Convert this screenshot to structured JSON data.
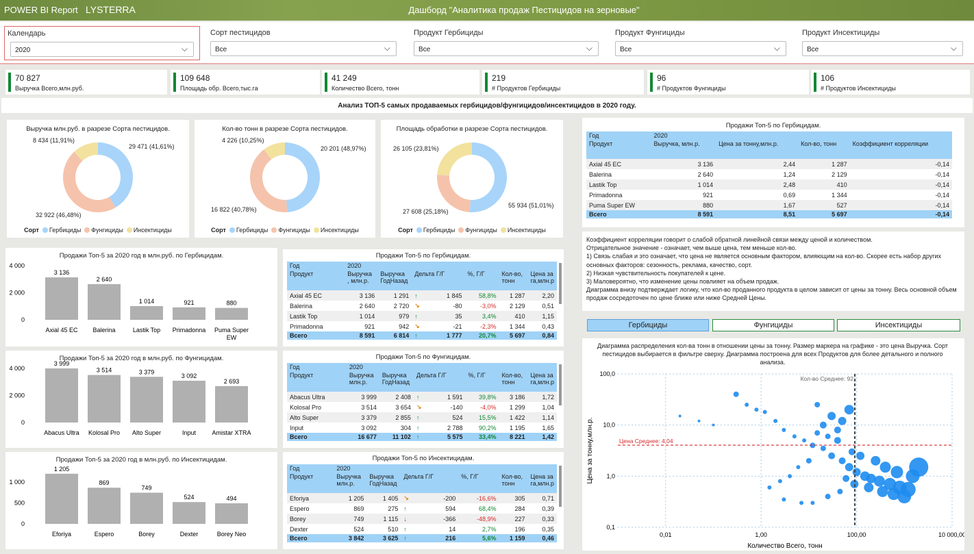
{
  "header": {
    "app": "POWER BI Report",
    "brand": "LYSTERRA",
    "title": "Дашборд \"Аналитика продаж Пестицидов на зерновые\""
  },
  "filters": [
    {
      "label": "Календарь",
      "value": "2020"
    },
    {
      "label": "Сорт пестицидов",
      "value": "Все"
    },
    {
      "label": "Продукт Гербициды",
      "value": "Все"
    },
    {
      "label": "Продукт Фунгициды",
      "value": "Все"
    },
    {
      "label": "Продукт Инсектициды",
      "value": "Все"
    }
  ],
  "kpis": [
    {
      "value": "70 827",
      "label": "Выручка Всего,млн.руб."
    },
    {
      "value": "109 648",
      "label": "Площадь обр. Всего,тыс.га"
    },
    {
      "value": "41 249",
      "label": "Количество Всего, тонн"
    },
    {
      "value": "219",
      "label": "# Продуктов Гербициды"
    },
    {
      "value": "96",
      "label": "# Продуктов Фунгициды"
    },
    {
      "value": "106",
      "label": "# Продуктов Инсектициды"
    }
  ],
  "section_title": "Анализ ТОП-5 самых продаваемых гербицидов/фунгицидов/инсектицидов в 2020 году.",
  "colors": {
    "herb": "#a8d4fa",
    "fung": "#f5c3ab",
    "insect": "#f2e29d",
    "bar": "#b0b0b0",
    "scatter": "#1e8cf0"
  },
  "legend": {
    "title": "Сорт",
    "items": [
      "Гербициды",
      "Фунгициды",
      "Инсектициды"
    ]
  },
  "donuts": [
    {
      "title": "Выручка млн.руб. в разрезе Сорта пестицидов.",
      "labels": [
        "29 471 (41,61%)",
        "32 922 (46,48%)",
        "8 434 (11,91%)"
      ],
      "values": [
        29471,
        32922,
        8434
      ]
    },
    {
      "title": "Кол-во тонн в разрезе Сорта пестицидов.",
      "labels": [
        "20 201 (48,97%)",
        "16 822 (40,78%)",
        "4 226 (10,25%)"
      ],
      "values": [
        20201,
        16822,
        4226
      ]
    },
    {
      "title": "Площадь обработки в разрезе Сорта пестицидов.",
      "labels": [
        "55 934 (51,01%)",
        "27 608 (25,18%)",
        "26 105 (23,81%)"
      ],
      "values": [
        55934,
        27608,
        26105
      ]
    }
  ],
  "bars": [
    {
      "title": "Продажи Топ-5 за 2020 год в млн.руб. по Гербицидам.",
      "ticks": [
        "4 000",
        "2 000",
        "0"
      ],
      "max": 4000,
      "categories": [
        "Axial 45 EC",
        "Balerina",
        "Lastik Top",
        "Primadonna",
        "Puma Super EW"
      ],
      "values": [
        3136,
        2640,
        1014,
        921,
        880
      ],
      "labels": [
        "3 136",
        "2 640",
        "1 014",
        "921",
        "880"
      ]
    },
    {
      "title": "Продажи Топ-5 за 2020 год в млн.руб. по Фунгицидам.",
      "ticks": [
        "4 000",
        "2 000",
        "0"
      ],
      "max": 4000,
      "categories": [
        "Abacus Ultra",
        "Kolosal Pro",
        "Alto Super",
        "Input",
        "Amistar XTRA"
      ],
      "values": [
        3999,
        3514,
        3379,
        3092,
        2693
      ],
      "labels": [
        "3 999",
        "3 514",
        "3 379",
        "3 092",
        "2 693"
      ]
    },
    {
      "title": "Продажи Топ-5 за 2020 год в млн.руб. по Инсектицидам.",
      "ticks": [
        "1 000",
        "500",
        "0"
      ],
      "max": 1300,
      "categories": [
        "Eforiya",
        "Espero",
        "Borey",
        "Dexter",
        "Borey Neo"
      ],
      "values": [
        1205,
        869,
        749,
        524,
        494
      ],
      "labels": [
        "1 205",
        "869",
        "749",
        "524",
        "494"
      ]
    }
  ],
  "tables": [
    {
      "title": "Продажи Топ-5 по Гербицидам.",
      "year_label": "Год",
      "year": "2020",
      "headers": [
        "Продукт",
        "Выручка , млн.р.",
        "Выручка ГодНазад",
        "Дельта Г/Г",
        "%, Г/Г",
        "Кол-во, тонн",
        "Цена за га,млн.р"
      ],
      "rows": [
        [
          "Axial 45 EC",
          "3 136",
          "1 291",
          "up",
          "1 845",
          "58,8%",
          "1 287",
          "2,20"
        ],
        [
          "Balerina",
          "2 640",
          "2 720",
          "dn",
          "-80",
          "-3,0%",
          "2 129",
          "0,51"
        ],
        [
          "Lastik Top",
          "1 014",
          "979",
          "up",
          "35",
          "3,4%",
          "410",
          "1,15"
        ],
        [
          "Primadonna",
          "921",
          "942",
          "dn",
          "-21",
          "-2,3%",
          "1 344",
          "0,43"
        ]
      ],
      "total": [
        "Всего",
        "8 591",
        "6 814",
        "up",
        "1 777",
        "20,7%",
        "5 697",
        "0,84"
      ]
    },
    {
      "title": "Продажи Топ-5 по Фунгицидам.",
      "year_label": "Год",
      "year": "2020",
      "headers": [
        "Продукт",
        "Выручка млн.р.",
        "Выручка ГодНазад",
        "Дельта Г/Г",
        "%, Г/Г",
        "Кол-во, тонн",
        "Цена за га,млн.р"
      ],
      "rows": [
        [
          "Abacus Ultra",
          "3 999",
          "2 408",
          "up",
          "1 591",
          "39,8%",
          "3 186",
          "1,72"
        ],
        [
          "Kolosal Pro",
          "3 514",
          "3 654",
          "dn",
          "-140",
          "-4,0%",
          "1 299",
          "1,04"
        ],
        [
          "Alto Super",
          "3 379",
          "2 855",
          "up",
          "524",
          "15,5%",
          "1 422",
          "1,14"
        ],
        [
          "Input",
          "3 092",
          "304",
          "up",
          "2 788",
          "90,2%",
          "1 195",
          "1,65"
        ]
      ],
      "total": [
        "Всего",
        "16 677",
        "11 102",
        "up",
        "5 575",
        "33,4%",
        "8 221",
        "1,42"
      ]
    },
    {
      "title": "Продажи Топ-5 по Инсектицидам.",
      "year_label": "Год",
      "year": "2020",
      "headers": [
        "Продукт",
        "Выручка млн.р.",
        "Выручка ГодНазад",
        "Дельта Г/Г",
        "%, Г/Г",
        "Кол-во, тонн",
        "Цена за га,млн.р"
      ],
      "rows": [
        [
          "Eforiya",
          "1 205",
          "1 405",
          "dn",
          "-200",
          "-16,6%",
          "305",
          "0,71"
        ],
        [
          "Espero",
          "869",
          "275",
          "up",
          "594",
          "68,4%",
          "284",
          "0,39"
        ],
        [
          "Borey",
          "749",
          "1 115",
          "dnr",
          "-366",
          "-48,9%",
          "227",
          "0,33"
        ],
        [
          "Dexter",
          "524",
          "510",
          "up",
          "14",
          "2,7%",
          "196",
          "0,35"
        ]
      ],
      "total": [
        "Всего",
        "3 842",
        "3 625",
        "up",
        "216",
        "5,6%",
        "1 159",
        "0,46"
      ]
    }
  ],
  "corr_table": {
    "title": "Продажи Топ-5 по Гербицидам.",
    "year_label": "Год",
    "year": "2020",
    "headers": [
      "Продукт",
      "Выручка, млн.р.",
      "Цена за тонну,млн.р.",
      "Кол-во, тонн",
      "Коэффициент корреляции"
    ],
    "rows": [
      [
        "Axial 45 EC",
        "3 136",
        "2,44",
        "1 287",
        "-0,14"
      ],
      [
        "Balerina",
        "2 640",
        "1,24",
        "2 129",
        "-0,14"
      ],
      [
        "Lastik Top",
        "1 014",
        "2,48",
        "410",
        "-0,14"
      ],
      [
        "Primadonna",
        "921",
        "0,69",
        "1 344",
        "-0,14"
      ],
      [
        "Puma Super EW",
        "880",
        "1,67",
        "527",
        "-0,14"
      ]
    ],
    "total": [
      "Всего",
      "8 591",
      "8,51",
      "5 697",
      "-0,14"
    ]
  },
  "notes": [
    "Коэффициент корреляции говорит о слабой обратной линейной связи между ценой и количеством.",
    "Отрицательное значение - означает, чем выше цена, тем меньше кол-во.",
    "1) Связь слабая и это означает, что цена не является основным фактором, влияющим на кол-во. Скорее есть набор других основных факторов: сезонность, реклама, качество, сорт.",
    "2) Низкая чувствительность покупателей к цене.",
    "3) Маловероятно, что изменение цены повлияет на объем продаж.",
    "Диаграмма внизу подтверждает логику, что кол-во проданного продукта в целом зависит от цены за тонну. Весь основной объем продаж сосредоточен по цене ближе или ниже Средней Цены."
  ],
  "tabs": [
    "Гербициды",
    "Фунгициды",
    "Инсектициды"
  ],
  "chart_data": [
    {
      "type": "pie",
      "title": "Выручка млн.руб. в разрезе Сорта пестицидов.",
      "categories": [
        "Гербициды",
        "Фунгициды",
        "Инсектициды"
      ],
      "values": [
        29471,
        32922,
        8434
      ]
    },
    {
      "type": "pie",
      "title": "Кол-во тонн в разрезе Сорта пестицидов.",
      "categories": [
        "Гербициды",
        "Фунгициды",
        "Инсектициды"
      ],
      "values": [
        20201,
        16822,
        4226
      ]
    },
    {
      "type": "pie",
      "title": "Площадь обработки в разрезе Сорта пестицидов.",
      "categories": [
        "Гербициды",
        "Фунгициды",
        "Инсектициды"
      ],
      "values": [
        55934,
        27608,
        26105
      ]
    },
    {
      "type": "bar",
      "title": "Продажи Топ-5 за 2020 год в млн.руб. по Гербицидам.",
      "categories": [
        "Axial 45 EC",
        "Balerina",
        "Lastik Top",
        "Primadonna",
        "Puma Super EW"
      ],
      "values": [
        3136,
        2640,
        1014,
        921,
        880
      ],
      "ylim": [
        0,
        4000
      ]
    },
    {
      "type": "bar",
      "title": "Продажи Топ-5 за 2020 год в млн.руб. по Фунгицидам.",
      "categories": [
        "Abacus Ultra",
        "Kolosal Pro",
        "Alto Super",
        "Input",
        "Amistar XTRA"
      ],
      "values": [
        3999,
        3514,
        3379,
        3092,
        2693
      ],
      "ylim": [
        0,
        4000
      ]
    },
    {
      "type": "bar",
      "title": "Продажи Топ-5 за 2020 год в млн.руб. по Инсектицидам.",
      "categories": [
        "Eforiya",
        "Espero",
        "Borey",
        "Dexter",
        "Borey Neo"
      ],
      "values": [
        1205,
        869,
        749,
        524,
        494
      ],
      "ylim": [
        0,
        1300
      ]
    },
    {
      "type": "scatter",
      "title": "Диаграмма распределения кол-ва тонн в отношении цены за тонну. Размер маркера на графике - это цена Выручка. Сорт пестицидов выбирается в фильтре сверху. Диаграмма построена для всех Продуктов для более детального и полного анализа.",
      "xlabel": "Количество Всего, тонн",
      "ylabel": "Цена за тонну,млн.р.",
      "xscale": "log",
      "yscale": "log",
      "xlim": [
        0.001,
        10000
      ],
      "ylim": [
        0.1,
        100
      ],
      "xticks": [
        "0,01",
        "1,00",
        "100,00",
        "10 000,00"
      ],
      "yticks": [
        "100,0",
        "10,0",
        "1,0",
        "0,1"
      ],
      "ref_x": {
        "label": "Кол-во Среднее: 92",
        "value": 92
      },
      "ref_y": {
        "label": "Цена Среднее: 4,04",
        "value": 4.04
      },
      "points": [
        [
          0.3,
          40,
          4
        ],
        [
          0.5,
          25,
          3
        ],
        [
          0.8,
          20,
          3
        ],
        [
          1.2,
          18,
          3
        ],
        [
          2,
          12,
          3
        ],
        [
          3,
          8,
          3
        ],
        [
          5,
          6,
          3
        ],
        [
          8,
          5,
          3
        ],
        [
          12,
          4,
          4
        ],
        [
          20,
          3.5,
          4
        ],
        [
          30,
          2.5,
          5
        ],
        [
          50,
          2,
          5
        ],
        [
          70,
          1.5,
          6
        ],
        [
          100,
          1.2,
          6
        ],
        [
          150,
          1,
          7
        ],
        [
          200,
          0.9,
          7
        ],
        [
          300,
          0.8,
          8
        ],
        [
          500,
          0.7,
          9
        ],
        [
          800,
          0.6,
          10
        ],
        [
          1200,
          0.55,
          11
        ],
        [
          2000,
          1.5,
          14
        ],
        [
          1500,
          1,
          10
        ],
        [
          700,
          1.2,
          9
        ],
        [
          400,
          1.5,
          8
        ],
        [
          250,
          2,
          7
        ],
        [
          120,
          2.5,
          6
        ],
        [
          80,
          3,
          5
        ],
        [
          40,
          5,
          5
        ],
        [
          25,
          6,
          4
        ],
        [
          15,
          7,
          4
        ],
        [
          10,
          2,
          4
        ],
        [
          6,
          1.5,
          3
        ],
        [
          4,
          1,
          3
        ],
        [
          2.5,
          0.8,
          3
        ],
        [
          1.5,
          0.6,
          3
        ],
        [
          60,
          0.9,
          5
        ],
        [
          90,
          0.7,
          6
        ],
        [
          180,
          0.6,
          7
        ],
        [
          350,
          0.5,
          8
        ],
        [
          600,
          0.45,
          9
        ],
        [
          1000,
          0.4,
          10
        ],
        [
          30,
          15,
          6
        ],
        [
          50,
          12,
          6
        ],
        [
          20,
          10,
          5
        ],
        [
          70,
          20,
          7
        ],
        [
          40,
          8,
          5
        ],
        [
          15,
          25,
          4
        ],
        [
          0.02,
          15,
          2
        ],
        [
          0.05,
          12,
          2
        ],
        [
          0.1,
          10,
          2
        ],
        [
          7,
          0.3,
          3
        ],
        [
          3,
          0.35,
          3
        ],
        [
          12,
          0.3,
          3
        ],
        [
          25,
          0.4,
          4
        ],
        [
          45,
          0.5,
          4
        ]
      ]
    }
  ]
}
